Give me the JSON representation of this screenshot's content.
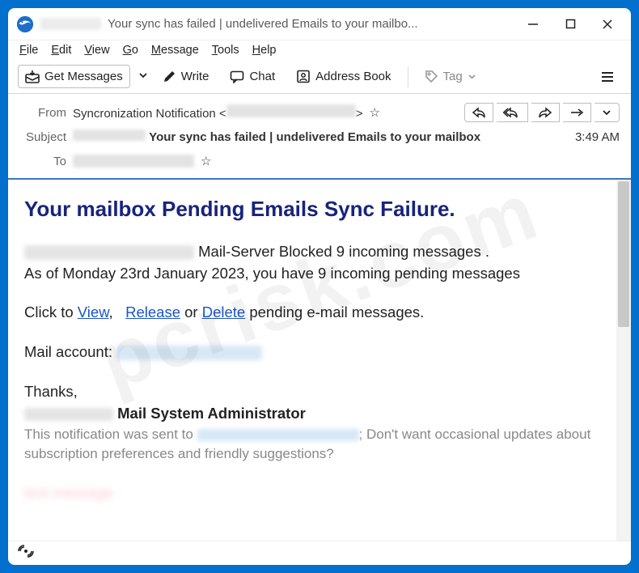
{
  "window": {
    "title_suffix": "Your sync has failed | undelivered Emails to your mailbo..."
  },
  "menubar": {
    "file": "File",
    "edit": "Edit",
    "view": "View",
    "go": "Go",
    "message": "Message",
    "tools": "Tools",
    "help": "Help"
  },
  "toolbar": {
    "get_messages": "Get Messages",
    "write": "Write",
    "chat": "Chat",
    "address_book": "Address Book",
    "tag": "Tag"
  },
  "headers": {
    "from_label": "From",
    "from_name": "Syncronization Notification <",
    "from_close": ">",
    "subject_label": "Subject",
    "subject_value": "Your sync has failed | undelivered Emails to your mailbox",
    "to_label": "To",
    "time": "3:49 AM"
  },
  "body": {
    "heading": "Your mailbox Pending Emails Sync Failure.",
    "line1_suffix": "Mail-Server Blocked 9 incoming messages .",
    "line2": "As of Monday 23rd January 2023, you have 9 incoming pending messages",
    "click_to": "Click to  ",
    "view": "View",
    "release": "Release",
    "or": " or   ",
    "delete": "Delete",
    "pending_suffix": " pending e-mail messages.",
    "mail_account": "Mail account:",
    "thanks": "Thanks,",
    "admin": "Mail System Administrator",
    "notif_prefix": "This notification was sent to ",
    "notif_suffix": "; Don't want occasional updates about subscription preferences and friendly suggestions?",
    "test": "test message"
  },
  "watermark": "pcrisk.com"
}
